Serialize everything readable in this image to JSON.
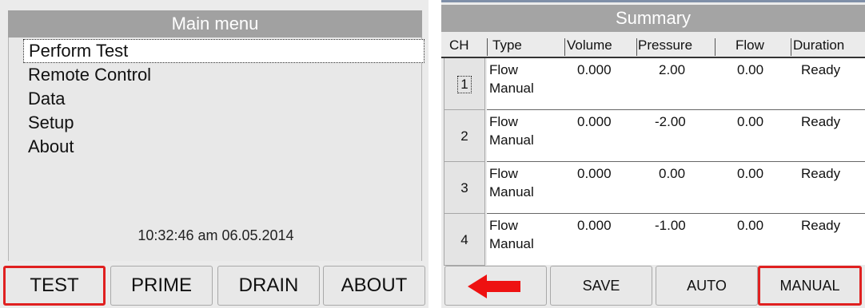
{
  "main_menu": {
    "title": "Main menu",
    "items": [
      "Perform Test",
      "Remote Control",
      "Data",
      "Setup",
      "About"
    ],
    "datetime": "10:32:46 am 06.05.2014",
    "buttons": [
      "TEST",
      "PRIME",
      "DRAIN",
      "ABOUT"
    ]
  },
  "summary": {
    "title": "Summary",
    "headers": [
      "CH",
      "Type",
      "Volume",
      "Pressure",
      "Flow",
      "Duration"
    ],
    "rows": [
      {
        "ch": "1",
        "type_line1": "Flow",
        "type_line2": "Manual",
        "volume": "0.000",
        "pressure": "2.00",
        "flow": "0.00",
        "duration": "Ready"
      },
      {
        "ch": "2",
        "type_line1": "Flow",
        "type_line2": "Manual",
        "volume": "0.000",
        "pressure": "-2.00",
        "flow": "0.00",
        "duration": "Ready"
      },
      {
        "ch": "3",
        "type_line1": "Flow",
        "type_line2": "Manual",
        "volume": "0.000",
        "pressure": "0.00",
        "flow": "0.00",
        "duration": "Ready"
      },
      {
        "ch": "4",
        "type_line1": "Flow",
        "type_line2": "Manual",
        "volume": "0.000",
        "pressure": "-1.00",
        "flow": "0.00",
        "duration": "Ready"
      }
    ],
    "buttons": {
      "back_icon": "left-arrow-icon",
      "save": "SAVE",
      "auto": "AUTO",
      "manual": "MANUAL"
    }
  },
  "colors": {
    "highlight_border": "#e02020",
    "back_arrow": "#ee1111",
    "title_bar": "#a1a1a1"
  }
}
